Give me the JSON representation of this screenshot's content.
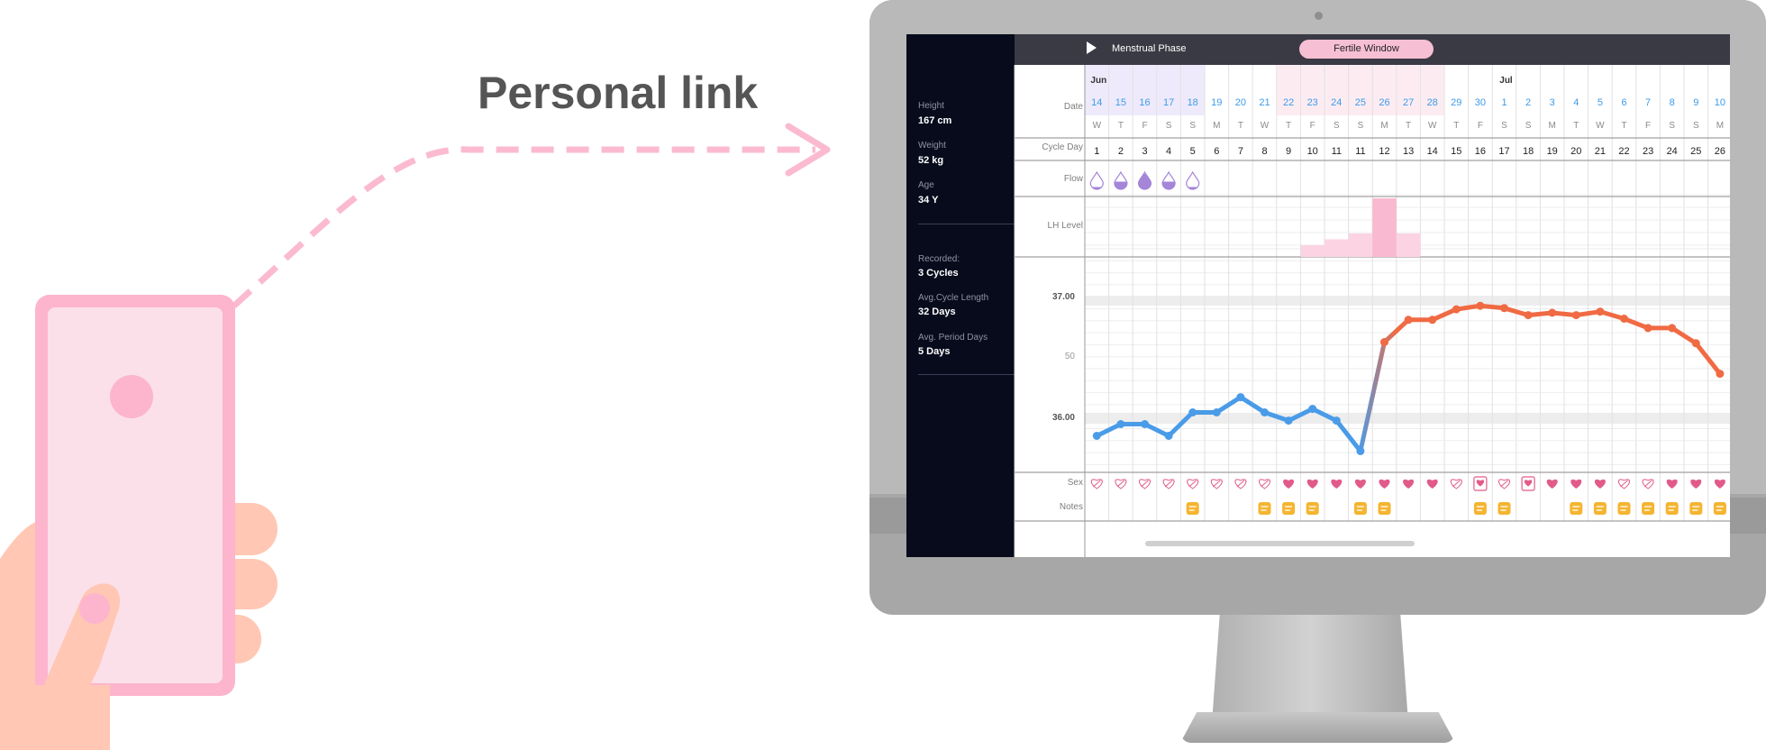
{
  "headline": "Personal link",
  "colors": {
    "pink_accent": "#fdb4cd",
    "pink_dash": "#fbbad0",
    "skin": "#ffc7b4",
    "panel_dark": "#070b1c",
    "phase_bar": "#3a3a44",
    "fertile_pill": "#f7bfd4",
    "date_blue": "#3d9be9",
    "temp_low": "#4a9be8",
    "temp_high": "#f06a43",
    "heart": "#e15b8a",
    "note": "#f4b531",
    "flow": "#a485d8"
  },
  "profile": {
    "height_label": "Height",
    "height_value": "167 cm",
    "weight_label": "Weight",
    "weight_value": "52 kg",
    "age_label": "Age",
    "age_value": "34 Y",
    "recorded_label": "Recorded:",
    "recorded_value": "3  Cycles",
    "avg_cycle_label": "Avg.Cycle Length",
    "avg_cycle_value": "32 Days",
    "avg_period_label": "Avg. Period Days",
    "avg_period_value": "5 Days"
  },
  "phase_bar": {
    "play_icon": "play-icon",
    "menstrual_label": "Menstrual Phase",
    "fertile_label": "Fertile Window"
  },
  "row_labels": {
    "date": "Date",
    "cycle_day": "Cycle Day",
    "flow": "Flow",
    "lh": "LH Level",
    "sex": "Sex",
    "notes": "Notes"
  },
  "temp_axis": {
    "top_label": "37.00",
    "mid_label": "50",
    "low_label": "36.00"
  },
  "calendar": {
    "months": [
      {
        "label": "Jun",
        "col": 0
      },
      {
        "label": "Jul",
        "col": 17
      }
    ],
    "dates": [
      "14",
      "15",
      "16",
      "17",
      "18",
      "19",
      "20",
      "21",
      "22",
      "23",
      "24",
      "25",
      "26",
      "27",
      "28",
      "29",
      "30",
      "1",
      "2",
      "3",
      "4",
      "5",
      "6",
      "7",
      "8",
      "9",
      "10"
    ],
    "weekdays": [
      "W",
      "T",
      "F",
      "S",
      "S",
      "M",
      "T",
      "W",
      "T",
      "F",
      "S",
      "S",
      "M",
      "T",
      "W",
      "T",
      "F",
      "S",
      "S",
      "M",
      "T",
      "W",
      "T",
      "F",
      "S",
      "S",
      "M"
    ],
    "cycle_days": [
      "1",
      "2",
      "3",
      "4",
      "5",
      "6",
      "7",
      "8",
      "9",
      "10",
      "11",
      "11",
      "12",
      "13",
      "14",
      "15",
      "16",
      "17",
      "18",
      "19",
      "20",
      "21",
      "22",
      "23",
      "24",
      "25",
      "26"
    ],
    "flow": [
      {
        "col": 0,
        "level": 0.15
      },
      {
        "col": 1,
        "level": 0.5
      },
      {
        "col": 2,
        "level": 1
      },
      {
        "col": 3,
        "level": 0.5
      },
      {
        "col": 4,
        "level": 0.15
      }
    ],
    "lh_levels": [
      0,
      0,
      0,
      0,
      0,
      0,
      0,
      0,
      0,
      1,
      1.5,
      2,
      5,
      2,
      0,
      0,
      0,
      0,
      0,
      0,
      0,
      0,
      0,
      0,
      0,
      0,
      0
    ],
    "temperature": [
      35.85,
      35.95,
      35.95,
      35.85,
      36.05,
      36.05,
      36.18,
      36.05,
      35.98,
      36.08,
      35.98,
      35.72,
      36.65,
      36.84,
      36.84,
      36.93,
      36.96,
      36.94,
      36.88,
      36.9,
      36.88,
      36.91,
      36.85,
      36.77,
      36.77,
      36.64,
      36.38
    ],
    "sex": [
      "empty",
      "empty",
      "empty",
      "empty",
      "empty",
      "empty",
      "empty",
      "empty",
      "full",
      "full",
      "full",
      "full",
      "full",
      "full",
      "full",
      "empty",
      "shield",
      "empty",
      "shield",
      "full",
      "full",
      "full",
      "empty",
      "empty",
      "full",
      "full",
      "full"
    ],
    "notes": [
      0,
      0,
      0,
      0,
      1,
      0,
      0,
      1,
      1,
      1,
      0,
      1,
      1,
      0,
      0,
      0,
      1,
      1,
      0,
      0,
      1,
      1,
      1,
      1,
      1,
      1,
      1
    ]
  }
}
